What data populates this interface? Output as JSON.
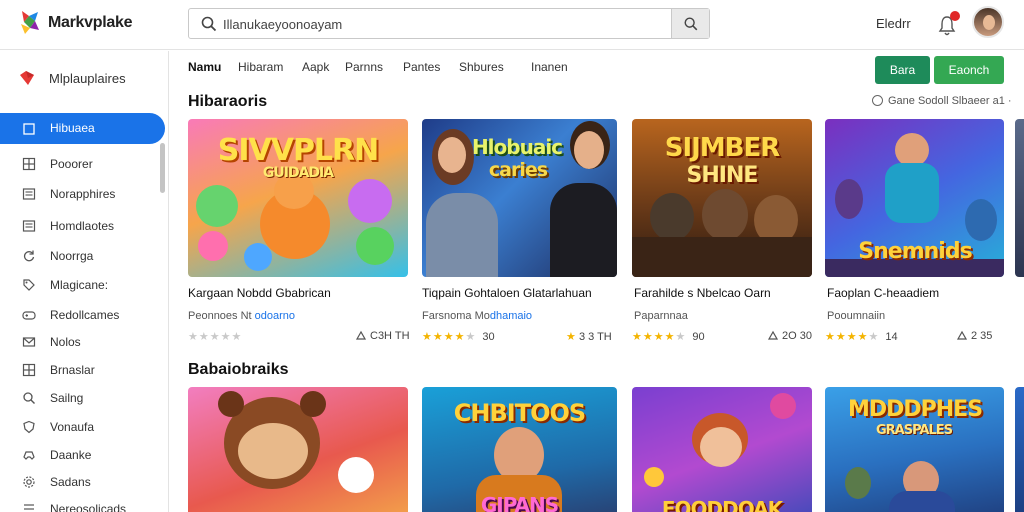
{
  "app": {
    "brand": "Markvplake",
    "brand_colors": [
      "#e53935",
      "#1e88e5",
      "#43a047",
      "#fbc02d"
    ]
  },
  "header": {
    "search_placeholder": "Illanukaeyoonoayam",
    "top_link": "Eledrr",
    "icons": [
      "search-icon",
      "notification-bell-icon",
      "user-avatar"
    ]
  },
  "sidebar": {
    "header_label": "Mlplauplaires",
    "items": [
      {
        "label": "Hibuaea",
        "icon": "home-icon",
        "active": true
      },
      {
        "label": "Pooorer",
        "icon": "grid-icon"
      },
      {
        "label": "Norapphires",
        "icon": "doc-icon"
      },
      {
        "label": "Homdlaotes",
        "icon": "doc-icon"
      },
      {
        "label": "Noorrga",
        "icon": "refresh-icon"
      },
      {
        "label": "Mlagicane:",
        "icon": "tag-icon"
      },
      {
        "label": "Redollcames",
        "icon": "gamepad-icon"
      },
      {
        "label": "Nolos",
        "icon": "mail-icon"
      },
      {
        "label": "Brnaslar",
        "icon": "grid-icon"
      },
      {
        "label": "Sailng",
        "icon": "search-icon"
      },
      {
        "label": "Vonaufa",
        "icon": "shield-icon"
      },
      {
        "label": "Daanke",
        "icon": "controller-icon"
      },
      {
        "label": "Sadans",
        "icon": "gear-icon"
      },
      {
        "label": "Nereosolicads",
        "icon": "list-icon"
      }
    ]
  },
  "tabs": [
    {
      "label": "Namu",
      "active": true
    },
    {
      "label": "Hibaram",
      "active": false
    },
    {
      "label": "Aapk",
      "active": false
    },
    {
      "label": "Parnns",
      "active": false
    },
    {
      "label": "Pantes",
      "active": false
    },
    {
      "label": "Shbures",
      "active": false
    },
    {
      "label": "Inanen",
      "active": false
    }
  ],
  "actions": {
    "primary_label": "Bara",
    "secondary_label": "Eaonch",
    "primary_color": "#1e8b5a",
    "secondary_color": "#34a853"
  },
  "sections": [
    {
      "title": "Hibaraoris",
      "link": "Gane Sodoll Slbaeer a1 ·",
      "cards": [
        {
          "art_title": "SIVVPLRN",
          "art_subtitle": "GUIDADIA",
          "title": "Kargaan Nobdd Gbabrican",
          "sub_prefix": "Peonnoes Nt",
          "sub_highlight": "odoarno",
          "rating": 5,
          "rating_text": "",
          "meta": "C3H TH",
          "stars_on": 0
        },
        {
          "art_title": "Hlobuaic",
          "art_subtitle": "caries",
          "title": "Tiqpain Gohtaloen Glatarlahuan",
          "sub_prefix": "Farsnoma Mo",
          "sub_highlight": "dhamaio",
          "rating_text": "30",
          "meta": "3 3 TH",
          "stars_on": 4
        },
        {
          "art_title": "SIJMBER",
          "art_subtitle": "SHINE",
          "title": "Farahilde s Nbelcao Oarn",
          "sub_prefix": "Paparnnaa",
          "sub_highlight": "",
          "rating_text": "90",
          "meta": "2O 30",
          "stars_on": 4
        },
        {
          "art_title": "Snemnids",
          "art_subtitle": "",
          "title": "Faoplan C-heaadiem",
          "sub_prefix": "Pooumnaiin",
          "sub_highlight": "",
          "rating_text": "14",
          "meta": "2 35",
          "stars_on": 4
        }
      ]
    },
    {
      "title": "Babaiobraiks",
      "cards": [
        {
          "art_title": "",
          "art_subtitle": ""
        },
        {
          "art_title": "CHBITOOS",
          "art_subtitle": "GIPANS"
        },
        {
          "art_title": "",
          "art_subtitle": "FOODDOAK"
        },
        {
          "art_title": "MDDDPHES",
          "art_subtitle": "GRASPALES"
        }
      ]
    }
  ]
}
